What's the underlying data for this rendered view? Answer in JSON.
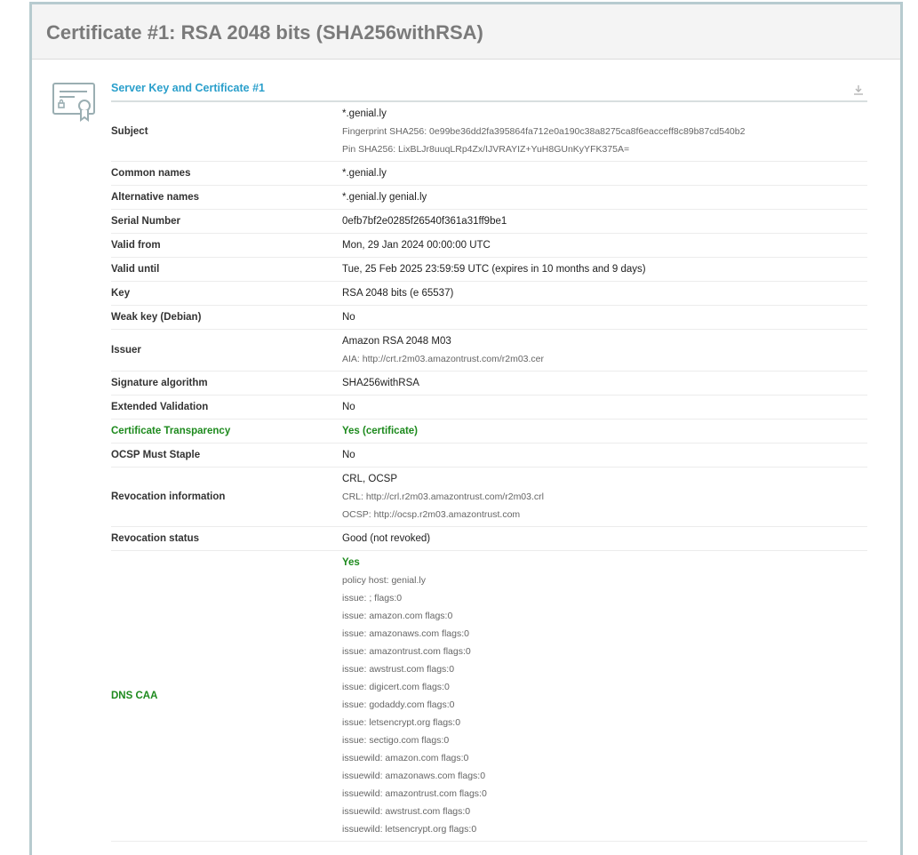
{
  "header": {
    "title": "Certificate #1: RSA 2048 bits (SHA256withRSA)"
  },
  "section": {
    "title": "Server Key and Certificate #1"
  },
  "icons": {
    "certificate": "certificate-icon",
    "download": "download-icon"
  },
  "colors": {
    "accent": "#2a9fcb",
    "good": "#1d8a1d",
    "frame": "#b7cbcf"
  },
  "rows": [
    {
      "label": "Subject",
      "lines": [
        "*.genial.ly"
      ],
      "sub": [
        "Fingerprint SHA256: 0e99be36dd2fa395864fa712e0a190c38a8275ca8f6eacceff8c89b87cd540b2",
        "Pin SHA256: LixBLJr8uuqLRp4Zx/IJVRAYIZ+YuH8GUnKyYFK375A="
      ]
    },
    {
      "label": "Common names",
      "lines": [
        "*.genial.ly"
      ]
    },
    {
      "label": "Alternative names",
      "lines": [
        "*.genial.ly genial.ly"
      ]
    },
    {
      "label": "Serial Number",
      "lines": [
        "0efb7bf2e0285f26540f361a31ff9be1"
      ]
    },
    {
      "label": "Valid from",
      "lines": [
        "Mon, 29 Jan 2024 00:00:00 UTC"
      ]
    },
    {
      "label": "Valid until",
      "lines": [
        "Tue, 25 Feb 2025 23:59:59 UTC (expires in 10 months and 9 days)"
      ]
    },
    {
      "label": "Key",
      "lines": [
        "RSA 2048 bits (e 65537)"
      ]
    },
    {
      "label": "Weak key (Debian)",
      "lines": [
        "No"
      ]
    },
    {
      "label": "Issuer",
      "lines": [
        "Amazon RSA 2048 M03"
      ],
      "sub": [
        "AIA: http://crt.r2m03.amazontrust.com/r2m03.cer"
      ]
    },
    {
      "label": "Signature algorithm",
      "lines": [
        "SHA256withRSA"
      ]
    },
    {
      "label": "Extended Validation",
      "lines": [
        "No"
      ]
    },
    {
      "label": "Certificate Transparency",
      "lines": [
        "Yes (certificate)"
      ],
      "status": "good"
    },
    {
      "label": "OCSP Must Staple",
      "lines": [
        "No"
      ]
    },
    {
      "label": "Revocation information",
      "lines": [
        "CRL, OCSP"
      ],
      "sub": [
        "CRL: http://crl.r2m03.amazontrust.com/r2m03.crl",
        "OCSP: http://ocsp.r2m03.amazontrust.com"
      ]
    },
    {
      "label": "Revocation status",
      "lines": [
        "Good (not revoked)"
      ]
    },
    {
      "label": "DNS CAA",
      "lines": [
        "Yes"
      ],
      "status": "good",
      "sub": [
        "policy host: genial.ly",
        "issue: ; flags:0",
        "issue: amazon.com flags:0",
        "issue: amazonaws.com flags:0",
        "issue: amazontrust.com flags:0",
        "issue: awstrust.com flags:0",
        "issue: digicert.com flags:0",
        "issue: godaddy.com flags:0",
        "issue: letsencrypt.org flags:0",
        "issue: sectigo.com flags:0",
        "issuewild: amazon.com flags:0",
        "issuewild: amazonaws.com flags:0",
        "issuewild: amazontrust.com flags:0",
        "issuewild: awstrust.com flags:0",
        "issuewild: letsencrypt.org flags:0"
      ]
    }
  ]
}
